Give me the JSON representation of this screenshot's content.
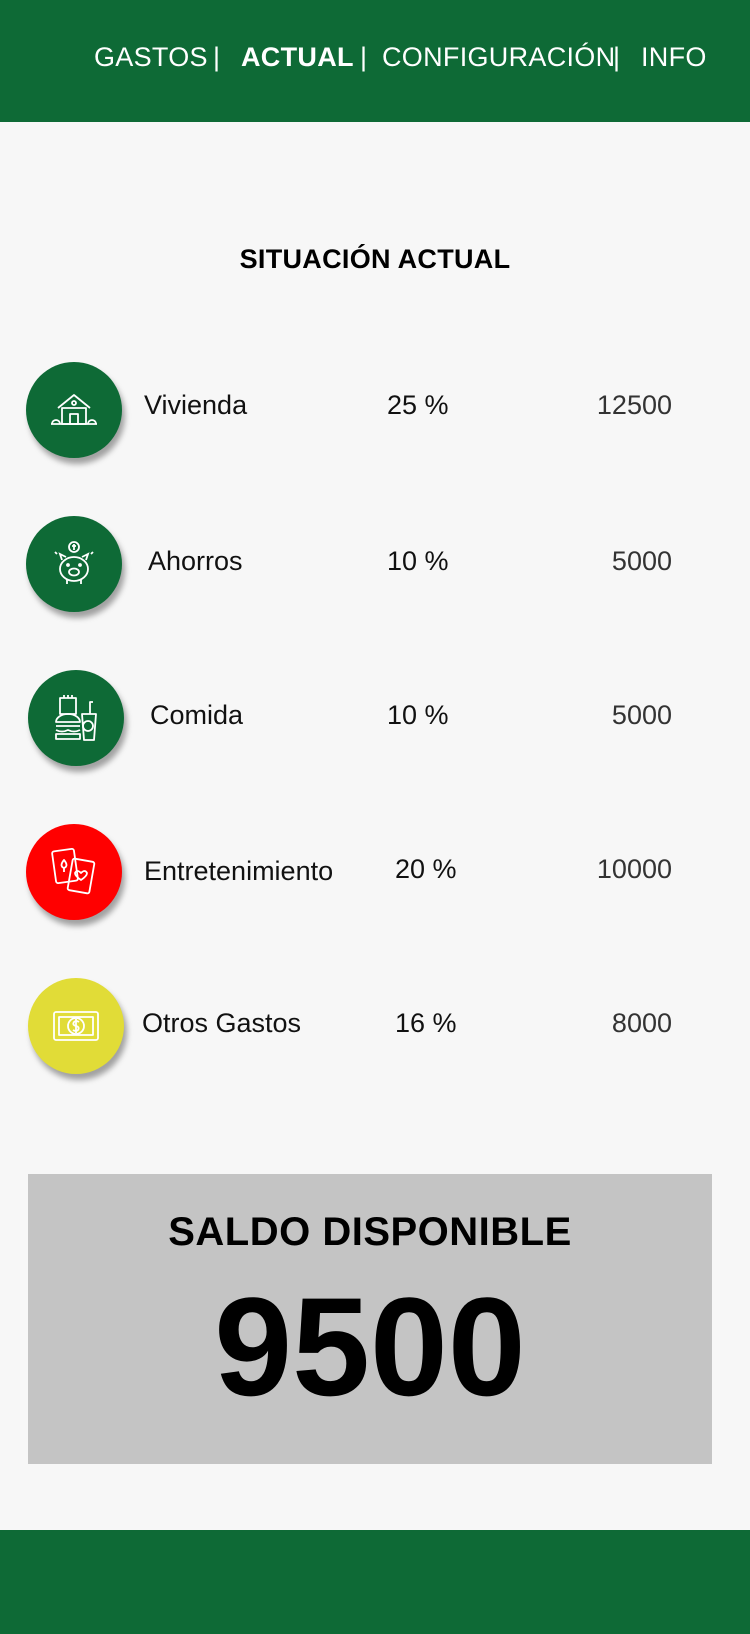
{
  "nav": {
    "items": [
      {
        "label": "GASTOS"
      },
      {
        "label": "ACTUAL"
      },
      {
        "label": "CONFIGURACIÓN"
      },
      {
        "label": "INFO"
      }
    ],
    "separator": "|"
  },
  "main": {
    "title": "SITUACIÓN ACTUAL",
    "categories": [
      {
        "name": "Vivienda",
        "percent": "25 %",
        "amount": "12500",
        "icon": "house-icon",
        "color": "#0e6a36"
      },
      {
        "name": "Ahorros",
        "percent": "10 %",
        "amount": "5000",
        "icon": "piggy-bank-icon",
        "color": "#0e6a36"
      },
      {
        "name": "Comida",
        "percent": "10 %",
        "amount": "5000",
        "icon": "fast-food-icon",
        "color": "#0e6a36"
      },
      {
        "name": "Entretenimiento",
        "percent": "20 %",
        "amount": "10000",
        "icon": "playing-cards-icon",
        "color": "#ff0000"
      },
      {
        "name": "Otros Gastos",
        "percent": "16 %",
        "amount": "8000",
        "icon": "money-bill-icon",
        "color": "#e1dc37"
      }
    ]
  },
  "balance": {
    "label": "SALDO DISPONIBLE",
    "value": "9500"
  },
  "colors": {
    "brand": "#0e6a36",
    "background": "#f7f7f7",
    "balance_panel": "#c4c4c4"
  }
}
